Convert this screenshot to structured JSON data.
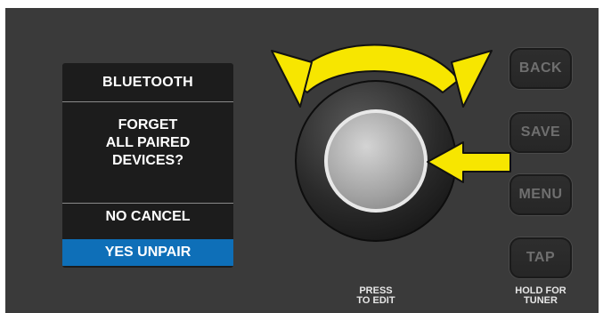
{
  "screen": {
    "title": "BLUETOOTH",
    "message_lines": [
      "FORGET",
      "ALL PAIRED",
      "DEVICES?"
    ],
    "options": [
      {
        "label": "NO CANCEL",
        "selected": false
      },
      {
        "label": "YES UNPAIR",
        "selected": true
      }
    ],
    "highlight_color": "#0e6fb8"
  },
  "buttons": [
    {
      "label": "BACK"
    },
    {
      "label": "SAVE"
    },
    {
      "label": "MENU"
    },
    {
      "label": "TAP"
    }
  ],
  "captions": {
    "encoder": [
      "PRESS",
      "TO EDIT"
    ],
    "tap": [
      "HOLD FOR",
      "TUNER"
    ]
  },
  "indicators": {
    "rotate_arrow": "double-curved-arrow-icon",
    "press_arrow": "left-arrow-icon",
    "arrow_color": "#f7e600"
  }
}
